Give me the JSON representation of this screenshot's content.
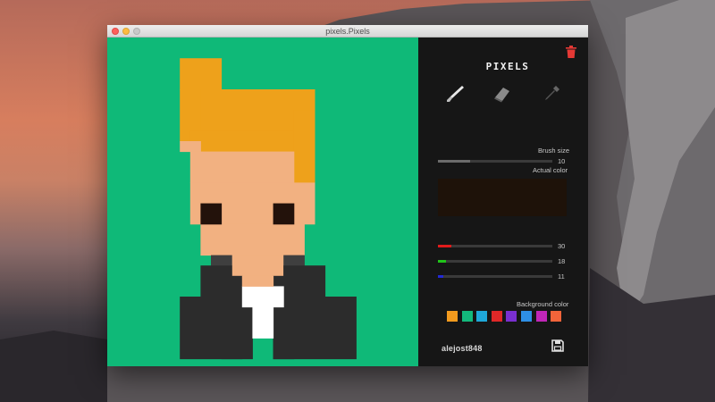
{
  "window": {
    "title": "pixels.Pixels"
  },
  "app": {
    "logo_text": "PIXELS",
    "username": "alejost848"
  },
  "colors": {
    "canvas_bg": "#0fb978",
    "hair": "#eea11b",
    "skin": "#f2b181",
    "eyes": "#23120b",
    "jacket": "#2c2c2c",
    "jacket_edge": "#3f3f3f",
    "shirt": "#ffffff",
    "trash": "#e53935",
    "red_fill": "#e01b1b",
    "green_fill": "#21c41a",
    "blue_fill": "#2329d6"
  },
  "tools": [
    {
      "name": "brush",
      "icon": "brush-icon",
      "active": true
    },
    {
      "name": "eraser",
      "icon": "eraser-icon",
      "active": false
    },
    {
      "name": "eyedropper",
      "icon": "eyedropper-icon",
      "active": false
    }
  ],
  "brush_size": {
    "label": "Brush size",
    "value": "10",
    "fraction": 0.28
  },
  "actual_color": {
    "label": "Actual color",
    "hex": "#1e1209"
  },
  "rgb": {
    "red": {
      "value": "30",
      "fraction": 0.118
    },
    "green": {
      "value": "18",
      "fraction": 0.071
    },
    "blue": {
      "value": "11",
      "fraction": 0.043
    }
  },
  "background_color": {
    "label": "Background color",
    "swatches": [
      "#f29a1e",
      "#13b97c",
      "#1fa8d9",
      "#e02828",
      "#7a2fd0",
      "#2e8fe6",
      "#c026b8",
      "#f2643a"
    ]
  }
}
